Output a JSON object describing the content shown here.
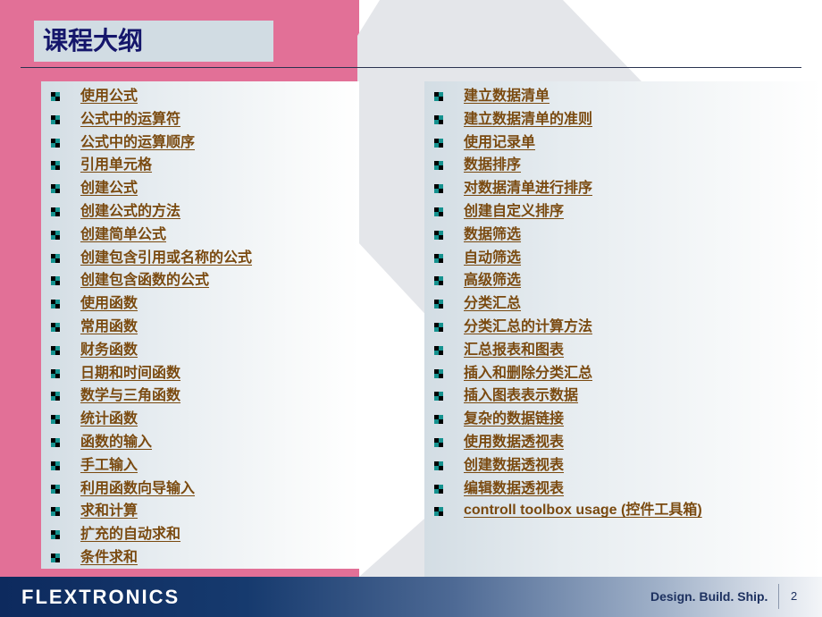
{
  "slide": {
    "title": "课程大纲",
    "page_number": "2"
  },
  "colors": {
    "pink_band": "#e27097",
    "title_text": "#15166b",
    "link_text": "#7a4a10",
    "bullet_dark": "#000000",
    "bullet_teal": "#15928f",
    "footer_dark": "#0d2a5e"
  },
  "left_column": {
    "items": [
      {
        "label": "使用公式",
        "icon": "checker-bullet-icon"
      },
      {
        "label": "公式中的运算符",
        "icon": "checker-bullet-icon"
      },
      {
        "label": "公式中的运算顺序",
        "icon": "checker-bullet-icon"
      },
      {
        "label": "引用单元格",
        "icon": "checker-bullet-icon"
      },
      {
        "label": "创建公式",
        "icon": "checker-bullet-icon"
      },
      {
        "label": "创建公式的方法",
        "icon": "checker-bullet-icon"
      },
      {
        "label": "创建简单公式",
        "icon": "checker-bullet-icon"
      },
      {
        "label": "创建包含引用或名称的公式",
        "icon": "checker-bullet-icon"
      },
      {
        "label": "创建包含函数的公式",
        "icon": "checker-bullet-icon"
      },
      {
        "label": "使用函数",
        "icon": "checker-bullet-icon"
      },
      {
        "label": "常用函数",
        "icon": "checker-bullet-icon"
      },
      {
        "label": "财务函数",
        "icon": "checker-bullet-icon"
      },
      {
        "label": "日期和时间函数",
        "icon": "checker-bullet-icon"
      },
      {
        "label": "数学与三角函数",
        "icon": "checker-bullet-icon"
      },
      {
        "label": "统计函数",
        "icon": "checker-bullet-icon"
      },
      {
        "label": "函数的输入",
        "icon": "checker-bullet-icon"
      },
      {
        "label": "手工输入",
        "icon": "checker-bullet-icon"
      },
      {
        "label": "利用函数向导输入",
        "icon": "checker-bullet-icon"
      },
      {
        "label": "求和计算",
        "icon": "checker-bullet-icon"
      },
      {
        "label": "扩充的自动求和",
        "icon": "checker-bullet-icon"
      },
      {
        "label": "条件求和",
        "icon": "checker-bullet-icon"
      }
    ]
  },
  "right_column": {
    "items": [
      {
        "label": "建立数据清单",
        "icon": "checker-bullet-icon"
      },
      {
        "label": "建立数据清单的准则",
        "icon": "checker-bullet-icon"
      },
      {
        "label": "使用记录单",
        "icon": "checker-bullet-icon"
      },
      {
        "label": "数据排序",
        "icon": "checker-bullet-icon"
      },
      {
        "label": "对数据清单进行排序",
        "icon": "checker-bullet-icon"
      },
      {
        "label": "创建自定义排序",
        "icon": "checker-bullet-icon"
      },
      {
        "label": "数据筛选",
        "icon": "checker-bullet-icon"
      },
      {
        "label": "自动筛选",
        "icon": "checker-bullet-icon"
      },
      {
        "label": "高级筛选",
        "icon": "checker-bullet-icon"
      },
      {
        "label": "分类汇总",
        "icon": "checker-bullet-icon"
      },
      {
        "label": "分类汇总的计算方法",
        "icon": "checker-bullet-icon"
      },
      {
        "label": "汇总报表和图表",
        "icon": "checker-bullet-icon"
      },
      {
        "label": "插入和删除分类汇总",
        "icon": "checker-bullet-icon"
      },
      {
        "label": "插入图表表示数据",
        "icon": "checker-bullet-icon"
      },
      {
        "label": "复杂的数据链接",
        "icon": "checker-bullet-icon"
      },
      {
        "label": "使用数据透视表",
        "icon": "checker-bullet-icon"
      },
      {
        "label": "创建数据透视表",
        "icon": "checker-bullet-icon"
      },
      {
        "label": "编辑数据透视表",
        "icon": "checker-bullet-icon"
      },
      {
        "label": "controll toolbox usage (控件工具箱)",
        "icon": "checker-bullet-icon",
        "latin": true
      }
    ]
  },
  "footer": {
    "logo": "FLEXTRONICS",
    "tagline": "Design. Build. Ship.",
    "page": "2"
  }
}
